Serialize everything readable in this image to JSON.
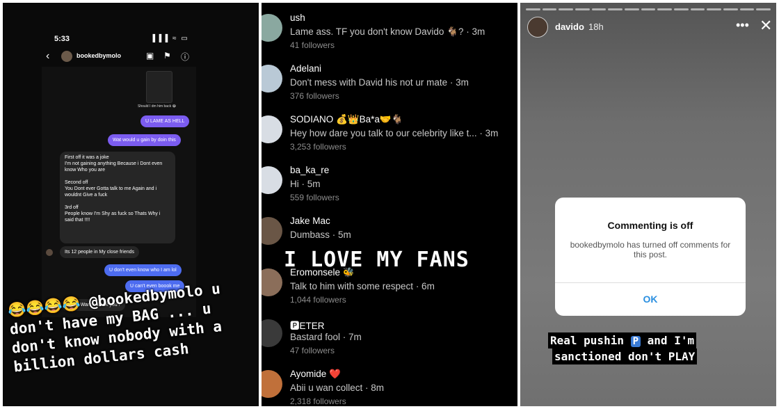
{
  "panel1": {
    "status_time": "5:33",
    "status_icons": "▐▐▐ ≈ ▭",
    "dm_username": "bookedbymolo",
    "back_icon": "‹",
    "video_icon": "▣",
    "flag_icon": "⚑",
    "info_icon": "ⓘ",
    "thumb_caption": "Should I dm him back 😂",
    "messages": [
      {
        "text": "U LAME AS HELL"
      },
      {
        "text": "Wat would u gain by doin this"
      },
      {
        "text": "First off it was a joke\nI'm not gaining anything Because i Dont even know Who you are\n\nSecond off\nYou Dont ever Gotta talk to me Again and i wouldnt Give a fuck\n\n3rd off\nPeople know I'm Shy as fuck so Thats Why i said that !!!!"
      },
      {
        "text": "Its 12 people in My close friends"
      },
      {
        "text": "U don't even know who I am lol"
      },
      {
        "text": "U can't even boook me"
      },
      {
        "text": "I Dont Wanna Book you !"
      }
    ],
    "caption_emojis": "😂😂😂😂",
    "caption_mention": "@bookedbymolo",
    "caption_rest": " u don't have my BAG ... u don't know nobody with a billion dollars cash"
  },
  "panel2": {
    "comments": [
      {
        "user": "ush",
        "text": "Lame ass. TF you don't know Davido 🐐? · 3m",
        "followers": "41 followers",
        "color": "#8aa8a0"
      },
      {
        "user": "Adelani",
        "text": "Don't mess with David his not ur mate · 3m",
        "followers": "376 followers",
        "color": "#b9c9d6"
      },
      {
        "user": "SODIANO 💰👑Ba*a🤝🐐",
        "text": "Hey how dare you talk to our celebrity like t... · 3m",
        "followers": "3,253 followers",
        "color": "#d8dde4"
      },
      {
        "user": "ba_ka_re",
        "text": "Hi · 5m",
        "followers": "559 followers",
        "color": "#d8dde4"
      },
      {
        "user": "Jake Mac",
        "text": "Dumbass · 5m",
        "followers": "",
        "color": "#6a5646"
      },
      {
        "user": "Eromonsele 🐝",
        "text": "Talk to him with some respect · 6m",
        "followers": "1,044 followers",
        "color": "#8b6e5a"
      },
      {
        "user": "🅿ETER",
        "text": "Bastard fool · 7m",
        "followers": "47 followers",
        "color": "#3a3a3a"
      },
      {
        "user": "Ayomide ❤️",
        "text": "Abii u wan collect · 8m",
        "followers": "2,318 followers",
        "color": "#c0703a"
      }
    ],
    "overlay_text": "I LOVE MY FANS"
  },
  "panel3": {
    "username": "davido",
    "time_ago": "18h",
    "more_icon": "•••",
    "close_icon": "✕",
    "dialog_title": "Commenting is off",
    "dialog_message": "bookedbymolo has turned off comments for this post.",
    "dialog_ok": "OK",
    "caption_line1_a": "Real pushin ",
    "caption_badge": "P",
    "caption_line1_b": " and I'm",
    "caption_line2": "sanctioned don't PLAY"
  }
}
